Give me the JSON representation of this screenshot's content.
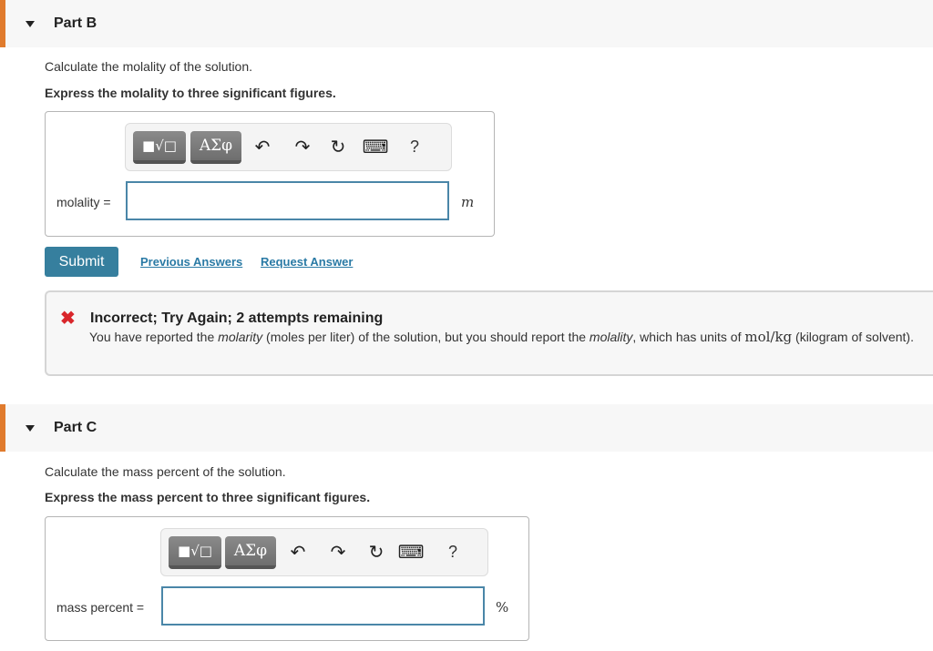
{
  "part_b": {
    "title": "Part B",
    "prompt": "Calculate the molality of the solution.",
    "instruction": "Express the molality to three significant figures.",
    "toolbar": {
      "templates_label": "■√□",
      "symbols_label": "ΑΣφ",
      "undo_icon": "↶",
      "redo_icon": "↷",
      "reset_icon": "↻",
      "keyboard_icon": "⌨",
      "help_label": "?"
    },
    "field_label": "molality =",
    "input_value": "",
    "unit": "m",
    "submit_label": "Submit",
    "previous_answers_label": "Previous Answers",
    "request_answer_label": "Request Answer",
    "feedback": {
      "status_icon": "✖",
      "title": "Incorrect; Try Again; 2 attempts remaining",
      "body_pre": "You have reported the ",
      "body_em1": "molarity",
      "body_mid": " (moles per liter) of the solution, but you should report the ",
      "body_em2": "molality",
      "body_mid2": ", which has units of ",
      "body_units": "mol/kg",
      "body_post": "  (kilogram of solvent)."
    }
  },
  "part_c": {
    "title": "Part C",
    "prompt": "Calculate the mass percent of the solution.",
    "instruction": "Express the mass percent to three significant figures.",
    "toolbar": {
      "templates_label": "■√□",
      "symbols_label": "ΑΣφ",
      "undo_icon": "↶",
      "redo_icon": "↷",
      "reset_icon": "↻",
      "keyboard_icon": "⌨",
      "help_label": "?"
    },
    "field_label": "mass percent =",
    "input_value": "",
    "unit": "%"
  },
  "colors": {
    "accent_bar": "#e07b2d",
    "submit": "#367f9e",
    "link": "#2a7aa5",
    "error": "#d9262b"
  }
}
